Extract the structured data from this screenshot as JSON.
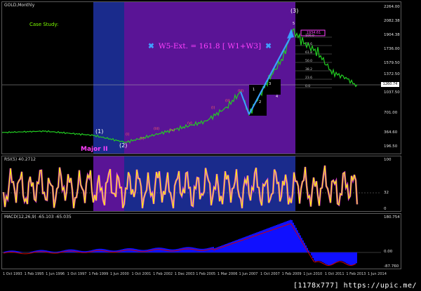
{
  "main": {
    "title": "GOLD,Monthly",
    "case_study": "Case Study:",
    "w5_text": "W5-Ext. = 161.8 [ W1+W3]",
    "w5_star": "✖",
    "wave_top": "(3)",
    "wave_1": "(1)",
    "wave_2": "(2)",
    "major_label": "Major II",
    "price_labels": [
      "2264.00",
      "2082.38",
      "1904.38",
      "1736.00",
      "1579.50",
      "1372.50",
      "1037.50",
      "701.00",
      "364.60",
      "196.50"
    ],
    "current_price": "1260.74",
    "highlight_price": "1934.61",
    "sub_waves_left": [
      "(i)",
      "(ii)",
      "(iii)",
      "(iv)",
      "(v)"
    ],
    "sub_waves_right": [
      "1",
      "2",
      "3",
      "4",
      "5"
    ],
    "fib_levels": [
      "100.0",
      "78.6",
      "61.8",
      "50.0",
      "38.2",
      "23.6",
      "0.0"
    ]
  },
  "rsi": {
    "title": "RSI(5) 40.2712",
    "levels": [
      "100",
      "32",
      "0"
    ]
  },
  "macd": {
    "title": "MACD(12,26,9) -65.103 -65.035",
    "levels": [
      "180.754",
      "0.00",
      "-87.760"
    ]
  },
  "time_axis": {
    "labels": [
      "1 Oct 1993",
      "1 Feb 1995",
      "1 Jun 1996",
      "1 Oct 1997",
      "1 Feb 1999",
      "1 Jun 2000",
      "1 Oct 2001",
      "1 Feb 2002",
      "1 Dec 2003",
      "1 Feb 2005",
      "1 Mar 2006",
      "1 Jun 2007",
      "1 Oct 2007",
      "1 Feb 2009",
      "1 Jun 2010",
      "1 Oct 2011",
      "1 Feb 2013",
      "1 Jun 2014"
    ]
  },
  "watermark": "[1178x777] https://upic.me/",
  "colors": {
    "price_line": "#22cc22",
    "wave_arrow": "#3aa0ff",
    "rsi_line": "#ffff00",
    "macd_hist": "#1010ff",
    "macd_signal": "#cc0000",
    "band_blue": "#1a2b8c",
    "band_purple": "#5a1496"
  }
}
